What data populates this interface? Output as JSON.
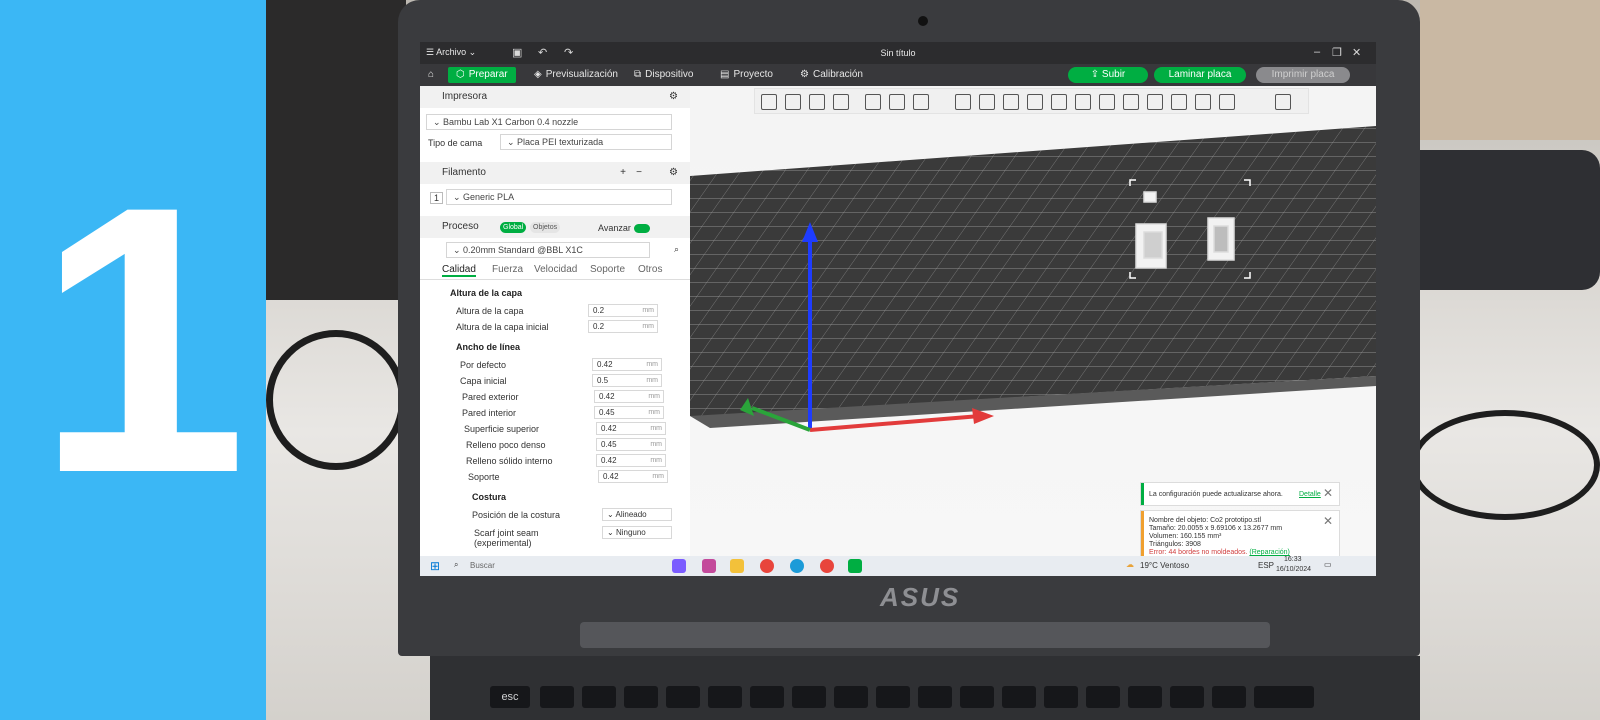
{
  "step": {
    "number": "1",
    "panel_color": "#3bb7f5"
  },
  "laptop": {
    "brand": "ASUS"
  },
  "window": {
    "menu_label": "Archivo",
    "title": "Sin título"
  },
  "tabs": [
    {
      "label": "Preparar",
      "active": true
    },
    {
      "label": "Previsualización",
      "active": false
    },
    {
      "label": "Dispositivo",
      "active": false
    },
    {
      "label": "Proyecto",
      "active": false
    },
    {
      "label": "Calibración",
      "active": false
    }
  ],
  "actions": {
    "upload": "Subir",
    "slice": "Laminar placa",
    "print": "Imprimir placa"
  },
  "printer": {
    "section": "Impresora",
    "model": "Bambu Lab X1 Carbon 0.4 nozzle",
    "bed_label": "Tipo de cama",
    "bed_value": "Placa PEI texturizada"
  },
  "filament": {
    "section": "Filamento",
    "slot": "1",
    "value": "Generic PLA"
  },
  "process": {
    "section": "Proceso",
    "global": "Global",
    "objects": "Objetos",
    "advance": "Avanzar",
    "profile": "0.20mm Standard @BBL X1C",
    "subtabs": [
      "Calidad",
      "Fuerza",
      "Velocidad",
      "Soporte",
      "Otros"
    ]
  },
  "settings": {
    "layer_group": "Altura de la capa",
    "layer_rows": [
      {
        "label": "Altura de la capa",
        "value": "0.2",
        "unit": "mm"
      },
      {
        "label": "Altura de la capa inicial",
        "value": "0.2",
        "unit": "mm"
      }
    ],
    "width_group": "Ancho de línea",
    "width_rows": [
      {
        "label": "Por defecto",
        "value": "0.42",
        "unit": "mm"
      },
      {
        "label": "Capa inicial",
        "value": "0.5",
        "unit": "mm"
      },
      {
        "label": "Pared exterior",
        "value": "0.42",
        "unit": "mm"
      },
      {
        "label": "Pared interior",
        "value": "0.45",
        "unit": "mm"
      },
      {
        "label": "Superficie superior",
        "value": "0.42",
        "unit": "mm"
      },
      {
        "label": "Relleno poco denso",
        "value": "0.45",
        "unit": "mm"
      },
      {
        "label": "Relleno sólido interno",
        "value": "0.42",
        "unit": "mm"
      },
      {
        "label": "Soporte",
        "value": "0.42",
        "unit": "mm"
      }
    ],
    "seam_group": "Costura",
    "seam_rows": [
      {
        "label": "Posición de la costura",
        "value": "Alineado"
      },
      {
        "label": "Scarf joint seam (experimental)",
        "value": "Ninguno"
      }
    ]
  },
  "notifications": {
    "update": {
      "text": "La configuración puede actualizarse ahora.",
      "link": "Detalle"
    },
    "object": {
      "name": "Nombre del objeto: Co2 prototipo.stl",
      "size": "Tamaño: 20.0055 x 9.69106 x 13.2677 mm",
      "volume": "Volumen: 160.155 mm³",
      "triangles": "Triángulos: 3908",
      "error": "Error: 44 bordes no moldeados.",
      "repair": "(Reparación)"
    }
  },
  "taskbar": {
    "search": "Buscar",
    "weather": "19°C Ventoso",
    "lang": "ESP",
    "time": "16:33",
    "date": "16/10/2024"
  }
}
